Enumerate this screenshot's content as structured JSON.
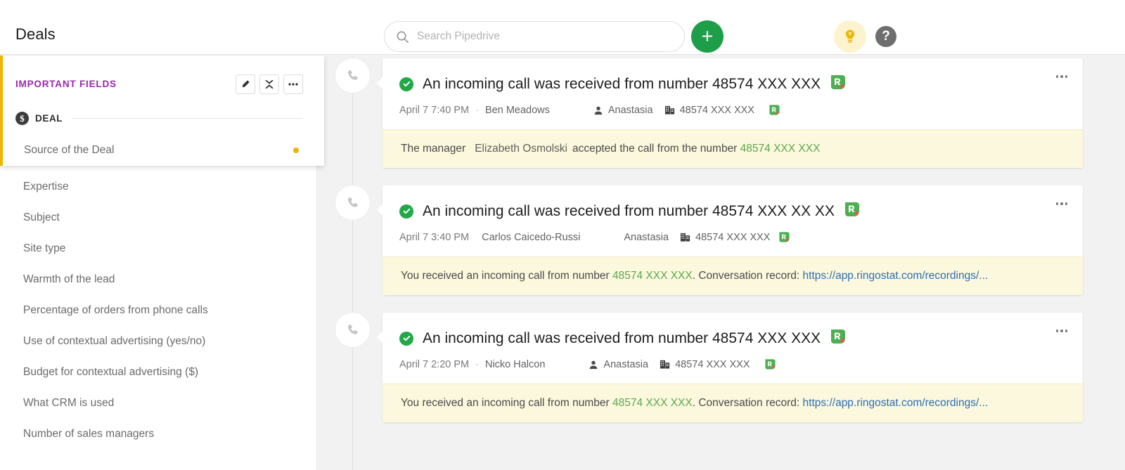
{
  "header": {
    "title": "Deals",
    "search": {
      "placeholder": "Search Pipedrive",
      "icon": "search-icon"
    },
    "add_button": {
      "label": "+",
      "icon": "plus-icon",
      "color": "#1e9e49"
    },
    "bulb_button": {
      "icon": "lightbulb-icon",
      "bg": "#fdf3cf",
      "color": "#f0b400"
    },
    "help_button": {
      "label": "?",
      "icon": "help-icon",
      "bg": "#6e6e6e"
    }
  },
  "sidebar": {
    "panel_title": "IMPORTANT FIELDS",
    "panel_accent": "#9c27b0",
    "panel_left_border": "#f0b400",
    "actions": [
      {
        "name": "edit-button",
        "icon": "pencil-icon"
      },
      {
        "name": "collapse-button",
        "icon": "collapse-icon"
      },
      {
        "name": "more-button",
        "icon": "ellipsis-icon"
      }
    ],
    "section": {
      "label": "DEAL",
      "icon": "dollar-coin-icon"
    },
    "highlighted_field": {
      "label": "Source of the Deal",
      "dot_color": "#f0b400"
    },
    "fields": [
      {
        "label": "Expertise"
      },
      {
        "label": "Subject"
      },
      {
        "label": "Site type"
      },
      {
        "label": "Warmth of the lead"
      },
      {
        "label": "Percentage of orders from phone calls"
      },
      {
        "label": "Use of contextual advertising (yes/no)"
      },
      {
        "label": "Budget for contextual advertising ($)"
      },
      {
        "label": "What CRM is used"
      },
      {
        "label": "Number of sales managers"
      }
    ]
  },
  "feed": {
    "entries": [
      {
        "icon": "phone-icon",
        "status_icon": "check-circle-icon",
        "headline": "An incoming call was received from number 48574 XXX XXX",
        "app_icon": "ringostat-icon",
        "time": "April 7 7:40 PM",
        "separator": "·",
        "author": "Ben Meadows",
        "person_icon": "person-icon",
        "person": "Anastasia",
        "org_icon": "organization-icon",
        "org": "48574 XXX XXX",
        "meta_app_icon": "ringostat-icon",
        "menu_icon": "ellipsis-icon",
        "note": {
          "prefix": "The manager",
          "name": "Elizabeth Osmolski",
          "middle": "accepted the call from the number",
          "number": "48574 XXX XXX",
          "suffix": "",
          "link": "",
          "number_color": "#5aa84f"
        }
      },
      {
        "icon": "phone-icon",
        "status_icon": "check-circle-icon",
        "headline": "An incoming call was received from number 48574 XXX XX XX",
        "app_icon": "ringostat-icon",
        "time": "April 7 3:40 PM",
        "separator": "",
        "author": "Carlos Caicedo-Russi",
        "person_icon": "",
        "person": "Anastasia",
        "org_icon": "organization-icon",
        "org": "48574 XXX XXX",
        "meta_app_icon": "ringostat-icon",
        "menu_icon": "ellipsis-icon",
        "note": {
          "prefix": "You received an incoming call from number",
          "name": "",
          "middle": "",
          "number": "48574 XXX XXX",
          "suffix": ". Conversation record:",
          "link": "https://app.ringostat.com/recordings/...",
          "number_color": "#5aa84f"
        }
      },
      {
        "icon": "phone-icon",
        "status_icon": "check-circle-icon",
        "headline": "An incoming call was received from number 48574 XXX XXX",
        "app_icon": "ringostat-icon",
        "time": "April 7 2:20 PM",
        "separator": "·",
        "author": "Nicko Halcon",
        "person_icon": "person-icon",
        "person": "Anastasia",
        "org_icon": "organization-icon",
        "org": "48574 XXX XXX",
        "meta_app_icon": "ringostat-icon",
        "menu_icon": "ellipsis-icon",
        "note": {
          "prefix": "You received an incoming call from number",
          "name": "",
          "middle": "",
          "number": "48574 XXX XXX",
          "suffix": ". Conversation record:",
          "link": "https://app.ringostat.com/recordings/...",
          "number_color": "#5aa84f"
        }
      }
    ]
  }
}
